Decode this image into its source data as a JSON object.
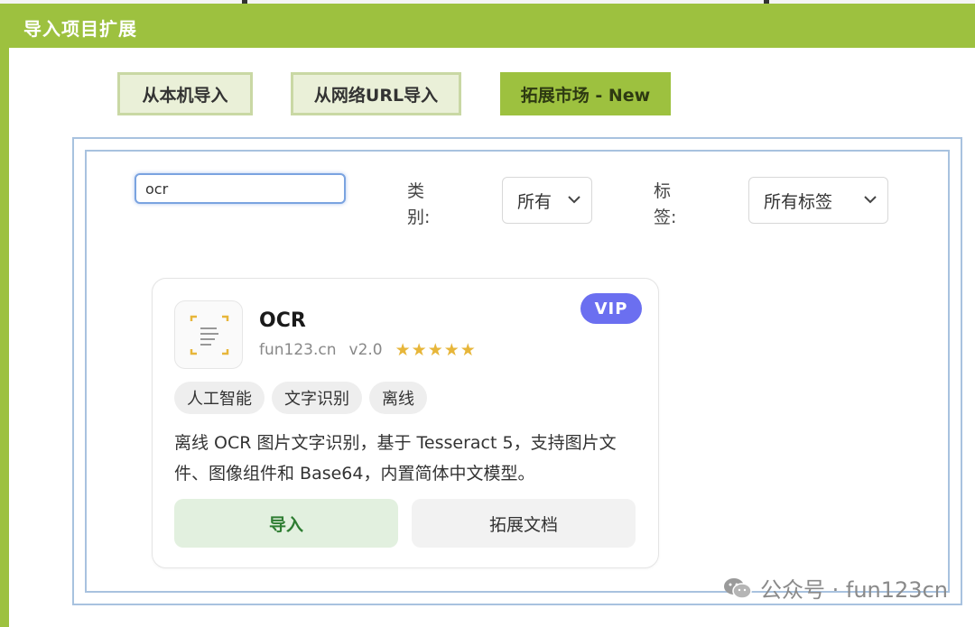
{
  "dialog": {
    "title": "导入项目扩展",
    "accent_color": "#9dc13f"
  },
  "tabs": [
    {
      "label": "从本机导入",
      "active": false
    },
    {
      "label": "从网络URL导入",
      "active": false
    },
    {
      "label": "拓展市场 - New",
      "active": true
    }
  ],
  "filters": {
    "search_value": "ocr",
    "category_label": "类别:",
    "category_selected": "所有",
    "tag_label": "标签:",
    "tag_selected": "所有标签"
  },
  "card": {
    "icon": "ocr-scan-icon",
    "name": "OCR",
    "author": "fun123.cn",
    "version": "v2.0",
    "rating": 5,
    "rating_stars": "★★★★★",
    "badge": "VIP",
    "badge_color": "#6b6ff0",
    "tags": [
      "人工智能",
      "文字识别",
      "离线"
    ],
    "description": "离线 OCR 图片文字识别，基于 Tesseract 5，支持图片文件、图像组件和 Base64，内置简体中文模型。",
    "import_label": "导入",
    "docs_label": "拓展文档"
  },
  "watermark": {
    "icon": "wechat-icon",
    "text": "公众号 · fun123cn"
  }
}
